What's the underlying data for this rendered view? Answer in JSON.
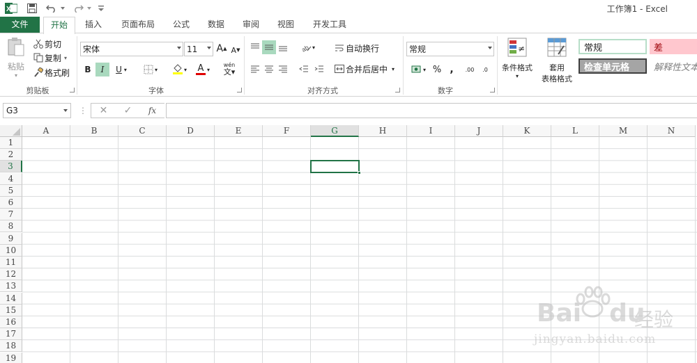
{
  "window": {
    "title": "工作簿1 - Excel"
  },
  "tabs": [
    "文件",
    "开始",
    "插入",
    "页面布局",
    "公式",
    "数据",
    "审阅",
    "视图",
    "开发工具"
  ],
  "clipboard": {
    "paste": "粘贴",
    "cut": "剪切",
    "copy": "复制",
    "format_painter": "格式刷",
    "group": "剪贴板"
  },
  "font": {
    "name": "宋体",
    "size": "11",
    "group": "字体",
    "bold": "B",
    "italic": "I",
    "underline": "U",
    "phonetic": "wén",
    "grow": "A",
    "shrink": "A",
    "color_a": "A"
  },
  "alignment": {
    "wrap": "自动换行",
    "merge": "合并后居中",
    "group": "对齐方式"
  },
  "number": {
    "format": "常规",
    "group": "数字",
    "percent": "%",
    "comma": ",",
    "inc_dec": ".00",
    "dec_dec": ".0"
  },
  "styles": {
    "conditional": "条件格式",
    "table_1": "套用",
    "table_2": "表格格式",
    "normal": "常规",
    "bad": "差",
    "check": "检查单元格",
    "explanatory": "解释性文本"
  },
  "formula_bar": {
    "name_box": "G3",
    "cancel": "✕",
    "enter": "✓",
    "fx": "fx",
    "more": "⋮",
    "value": ""
  },
  "sheet": {
    "columns": [
      "A",
      "B",
      "C",
      "D",
      "E",
      "F",
      "G",
      "H",
      "I",
      "J",
      "K",
      "L",
      "M",
      "N"
    ],
    "rows": [
      "1",
      "2",
      "3",
      "4",
      "5",
      "6",
      "7",
      "8",
      "9",
      "10",
      "11",
      "12",
      "13",
      "14",
      "15",
      "16",
      "17",
      "18",
      "19"
    ],
    "selected_col": "G",
    "selected_row": "3"
  },
  "watermark": {
    "brand": "Bai",
    "du": "du",
    "jy": "经验",
    "url": "jingyan.baidu.com"
  },
  "colors": {
    "accent": "#217346",
    "bad_fill": "#ffc7ce",
    "bad_text": "#9c0006",
    "check_fill": "#a5a5a5"
  }
}
